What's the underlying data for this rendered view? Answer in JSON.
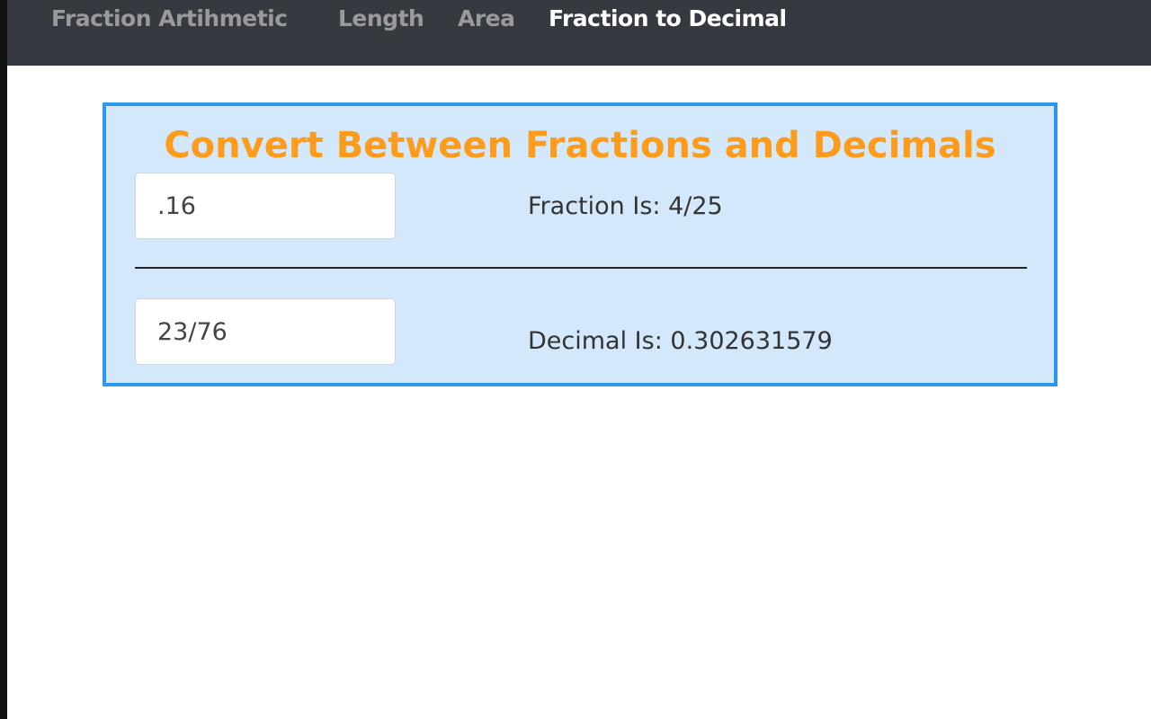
{
  "nav": {
    "items": [
      {
        "label": "Fraction Artihmetic"
      },
      {
        "label": "Length"
      },
      {
        "label": "Area"
      },
      {
        "label": "Fraction to Decimal"
      }
    ],
    "active_index": 3
  },
  "converter": {
    "title": "Convert Between Fractions and Decimals",
    "decimal_to_fraction": {
      "input_value": ".16",
      "result_text": "Fraction Is: 4/25"
    },
    "fraction_to_decimal": {
      "input_value": "23/76",
      "result_text": "Decimal Is: 0.302631579"
    }
  },
  "colors": {
    "navbar_bg": "#343a40",
    "nav_inactive": "#9a9a9a",
    "nav_active": "#ffffff",
    "panel_bg": "#d3e8fb",
    "panel_border": "#2b97f0",
    "title": "#ff9b1a"
  }
}
